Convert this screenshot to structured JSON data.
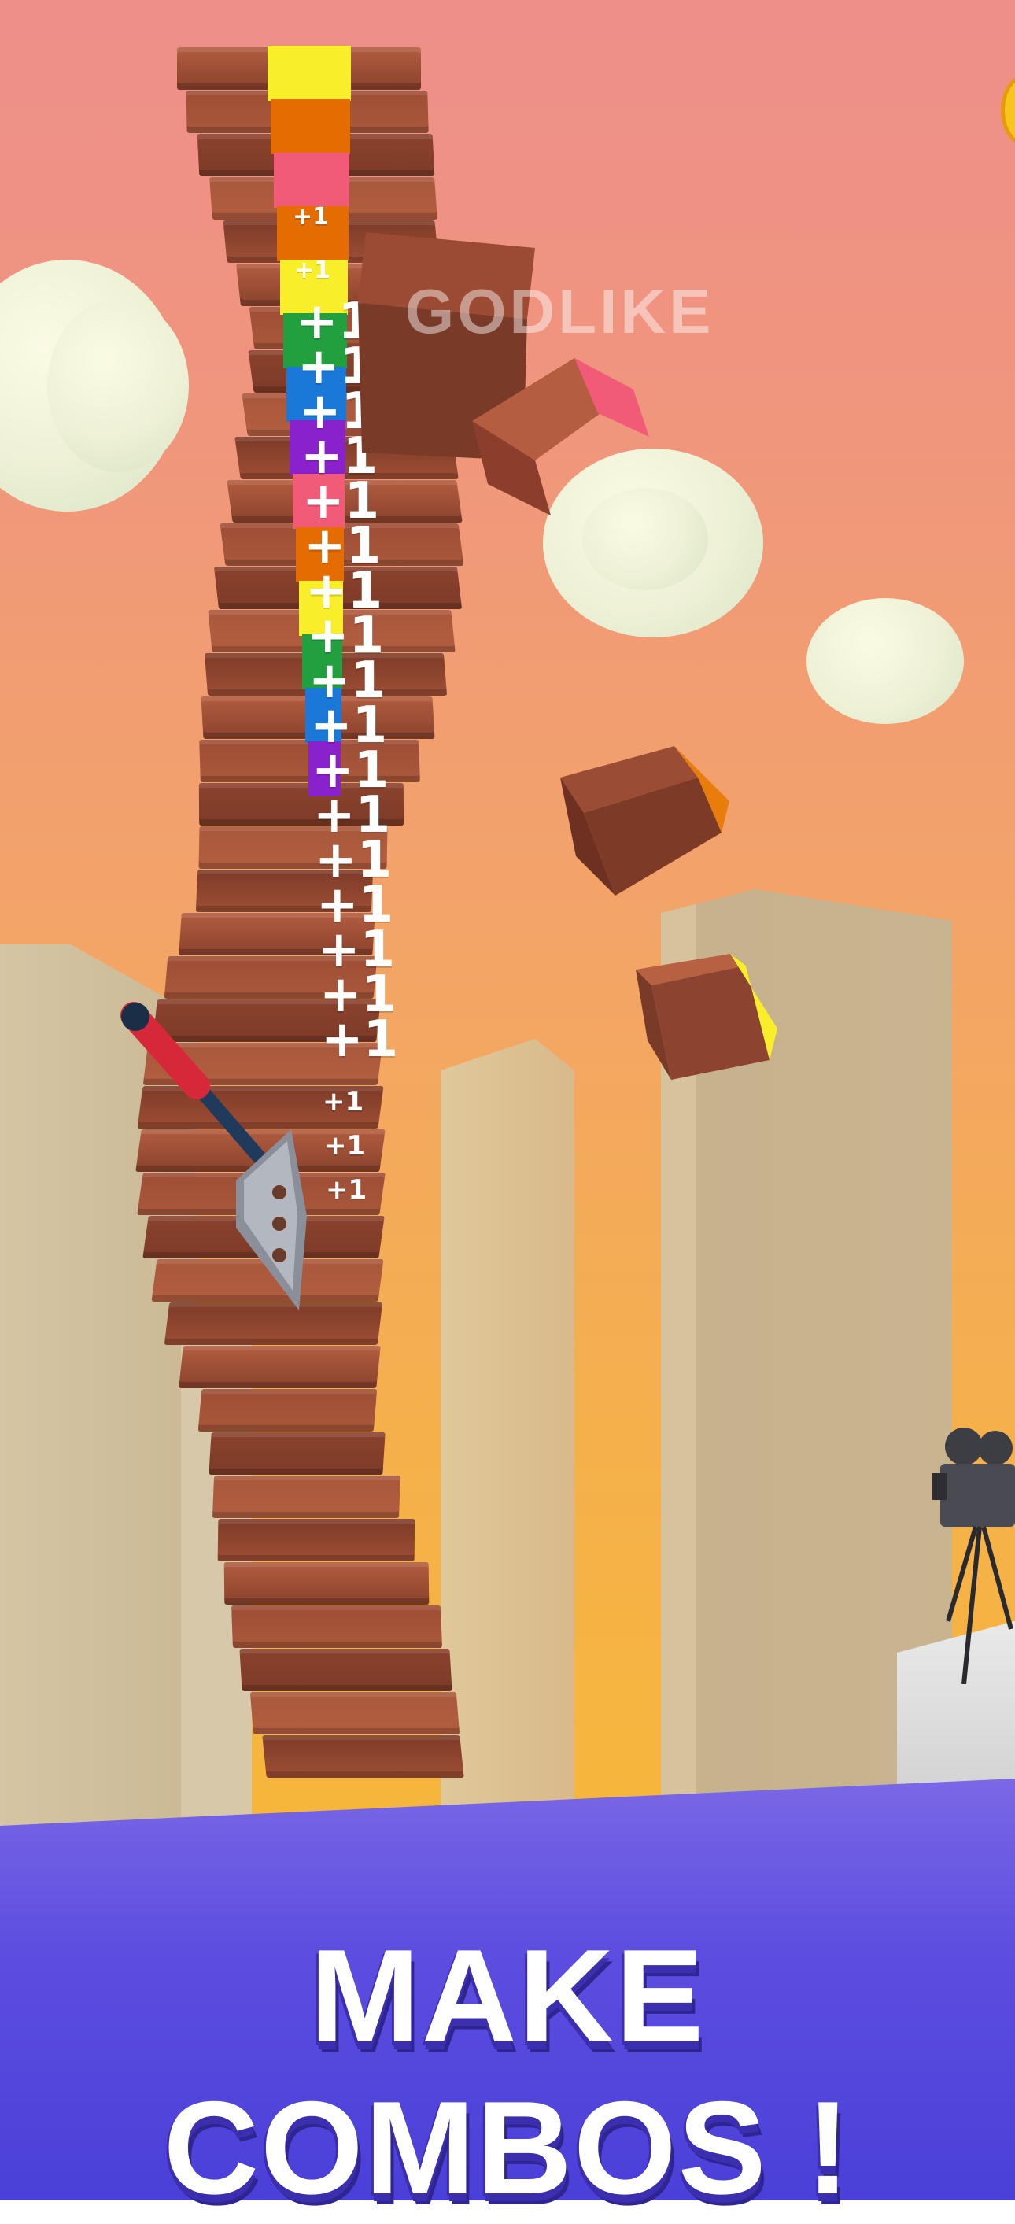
{
  "game": {
    "combo_rating": "GODLIKE",
    "score_popups": [
      "+1",
      "+1",
      "+1",
      "+1",
      "+1",
      "+1",
      "+1",
      "+1",
      "+1",
      "+1",
      "+1",
      "+1",
      "+1",
      "+1",
      "+1",
      "+1",
      "+1",
      "+1",
      "+1",
      "+1",
      "+1",
      "+1"
    ],
    "stripe_colors": [
      "#f8ee2a",
      "#e46c00",
      "#f25b78",
      "#e46c00",
      "#f8ee2a",
      "#22a040",
      "#1a78d8",
      "#8a22cc",
      "#f25b78",
      "#e46c00",
      "#f8ee2a",
      "#22a040",
      "#1a78d8",
      "#8a22cc"
    ],
    "brick_color": "#a8553a"
  },
  "banner": {
    "headline": "MAKE COMBOS !"
  },
  "colors": {
    "sky_top": "#ee8f8a",
    "sky_bottom": "#f6b63c",
    "banner": "#5246dd"
  },
  "icons": [
    "axe-icon",
    "camera-icon",
    "coin-icon"
  ]
}
